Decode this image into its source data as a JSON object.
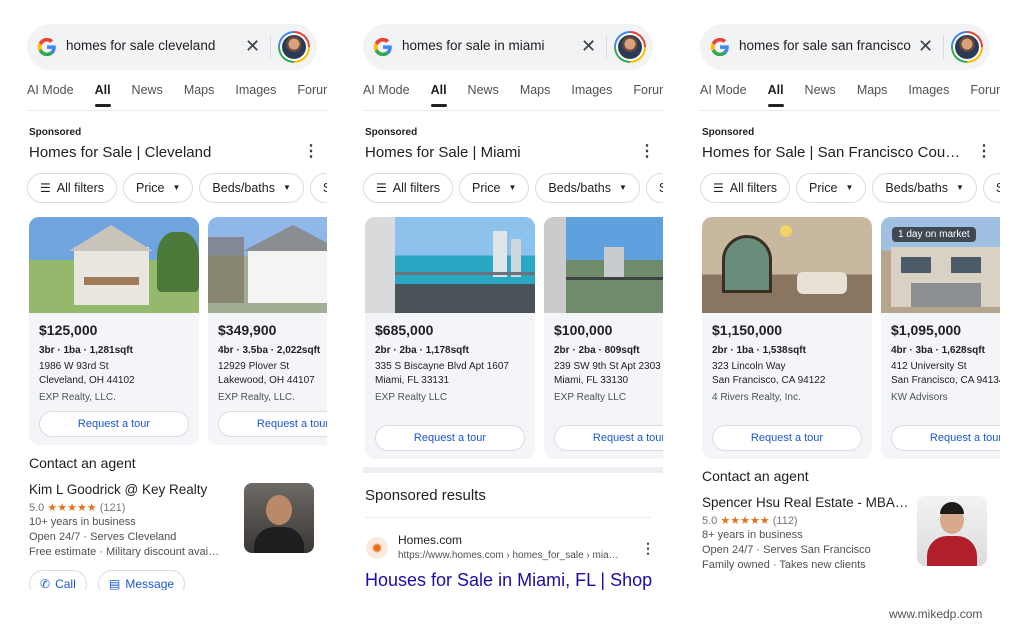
{
  "tabs": [
    "AI Mode",
    "All",
    "News",
    "Maps",
    "Images",
    "Forums"
  ],
  "active_tab": "All",
  "sponsored_label": "Sponsored",
  "filters": {
    "all_filters": "All filters",
    "price": "Price",
    "beds_baths": "Beds/baths"
  },
  "colors": {
    "link_blue": "#1a57d6",
    "star_orange": "#e7711b",
    "card_bg": "#f3f5f9"
  },
  "panels": [
    {
      "query": "homes for sale cleveland",
      "section_title": "Homes for Sale | Cleveland",
      "listings": [
        {
          "price": "$125,000",
          "specs": "3br · 1ba · 1,281sqft",
          "addr1": "1986 W 93rd St",
          "addr2": "Cleveland, OH 44102",
          "agency": "EXP Realty, LLC.",
          "tour": "Request a tour"
        },
        {
          "price": "$349,900",
          "specs": "4br · 3.5ba · 2,022sqft",
          "addr1": "12929 Plover St",
          "addr2": "Lakewood, OH 44107",
          "agency": "EXP Realty, LLC.",
          "tour": "Request a tour"
        }
      ],
      "contact_heading": "Contact an agent",
      "agent": {
        "name": "Kim L Goodrick @ Key Realty",
        "rating": "5.0",
        "stars": "★★★★★",
        "reviews": "(121)",
        "experience": "10+ years in business",
        "hours": "Open 24/7  ·  Serves Cleveland",
        "extras": "Free estimate · Military discount avai…",
        "call": "Call",
        "message": "Message"
      }
    },
    {
      "query": "homes for sale in miami",
      "section_title": "Homes for Sale | Miami",
      "listings": [
        {
          "price": "$685,000",
          "specs": "2br · 2ba · 1,178sqft",
          "addr1": "335 S Biscayne Blvd Apt 1607",
          "addr2": "Miami, FL 33131",
          "agency": "EXP Realty LLC",
          "tour": "Request a tour"
        },
        {
          "price": "$100,000",
          "specs": "2br · 2ba · 809sqft",
          "addr1": "239 SW 9th St Apt 2303",
          "addr2": "Miami, FL 33130",
          "agency": "EXP Realty LLC",
          "tour": "Request a tour"
        }
      ],
      "sponsored_results": {
        "title": "Sponsored results",
        "site": "Homes.com",
        "url": "https://www.homes.com › homes_for_sale › mia…",
        "link": "Houses for Sale in Miami, FL | Shop"
      }
    },
    {
      "query": "homes for sale san francisco",
      "section_title": "Homes for Sale | San Francisco Cou…",
      "listings": [
        {
          "price": "$1,150,000",
          "specs": "2br · 1ba · 1,538sqft",
          "addr1": "323 Lincoln Way",
          "addr2": "San Francisco, CA 94122",
          "agency": "4 Rivers Realty, Inc.",
          "tour": "Request a tour"
        },
        {
          "price": "$1,095,000",
          "badge": "1 day on market",
          "specs": "4br · 3ba · 1,628sqft",
          "addr1": "412 University St",
          "addr2": "San Francisco, CA 94134",
          "agency": "KW Advisors",
          "tour": "Request a tour"
        }
      ],
      "contact_heading": "Contact an agent",
      "agent": {
        "name": "Spencer Hsu Real Estate - MBA…",
        "rating": "5.0",
        "stars": "★★★★★",
        "reviews": "(112)",
        "experience": "8+ years in business",
        "hours": "Open 24/7  ·  Serves San Francisco",
        "extras": "Family owned · Takes new clients"
      }
    }
  ],
  "watermark": "www.mikedp.com"
}
